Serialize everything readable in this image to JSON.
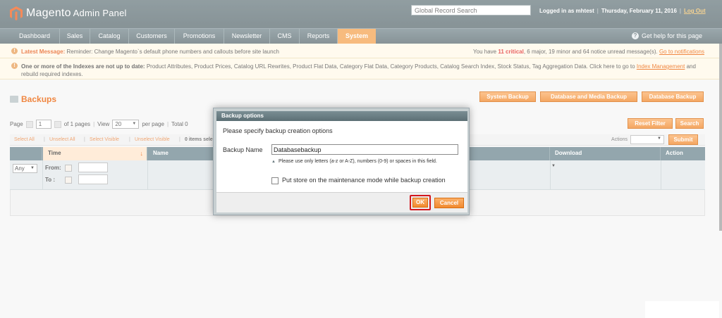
{
  "header": {
    "logo_main": "Magento",
    "logo_sub": "Admin Panel",
    "search_placeholder": "Global Record Search",
    "logged_in": "Logged in as mhtest",
    "date": "Thursday, February 11, 2016",
    "logout": "Log Out"
  },
  "nav": {
    "items": [
      "Dashboard",
      "Sales",
      "Catalog",
      "Customers",
      "Promotions",
      "Newsletter",
      "CMS",
      "Reports",
      "System"
    ],
    "active": "System",
    "help": "Get help for this page"
  },
  "notices": {
    "latest_label": "Latest Message:",
    "latest_text": "Reminder: Change Magento`s default phone numbers and callouts before site launch",
    "counts_prefix": "You have",
    "critical": "11 critical",
    "counts_rest": ", 6 major, 19 minor and 64 notice unread message(s).",
    "goto": "Go to notifications",
    "index_bold": "One or more of the Indexes are not up to date:",
    "index_text": "Product Attributes, Product Prices, Catalog URL Rewrites, Product Flat Data, Category Flat Data, Category Products, Catalog Search Index, Stock Status, Tag Aggregation Data. Click here to go to",
    "index_link": "Index Management",
    "index_tail": "and rebuild required indexes."
  },
  "page": {
    "title": "Backups",
    "buttons": [
      "System Backup",
      "Database and Media Backup",
      "Database Backup"
    ],
    "reset_filter": "Reset Filter",
    "search": "Search"
  },
  "pager": {
    "page_label": "Page",
    "page_value": "1",
    "of_pages": "of 1 pages",
    "view_label": "View",
    "view_value": "20",
    "per_page": "per page",
    "total": "Total 0"
  },
  "massaction": {
    "select_all": "Select All",
    "unselect_all": "Unselect All",
    "select_visible": "Select Visible",
    "unselect_visible": "Unselect Visible",
    "items_selected": "0 items sele",
    "actions_label": "Actions",
    "submit": "Submit"
  },
  "grid": {
    "columns": [
      "Time",
      "Name",
      "Download",
      "Action"
    ],
    "any": "Any",
    "from": "From:",
    "to": "To :"
  },
  "modal": {
    "title": "Backup options",
    "description": "Please specify backup creation options",
    "name_label": "Backup Name",
    "name_value": "Databasebackup",
    "hint": "Please use only letters (a-z or A-Z), numbers (0-9) or spaces in this field.",
    "checkbox_label": "Put store on the maintenance mode while backup creation",
    "ok": "OK",
    "cancel": "Cancel"
  }
}
